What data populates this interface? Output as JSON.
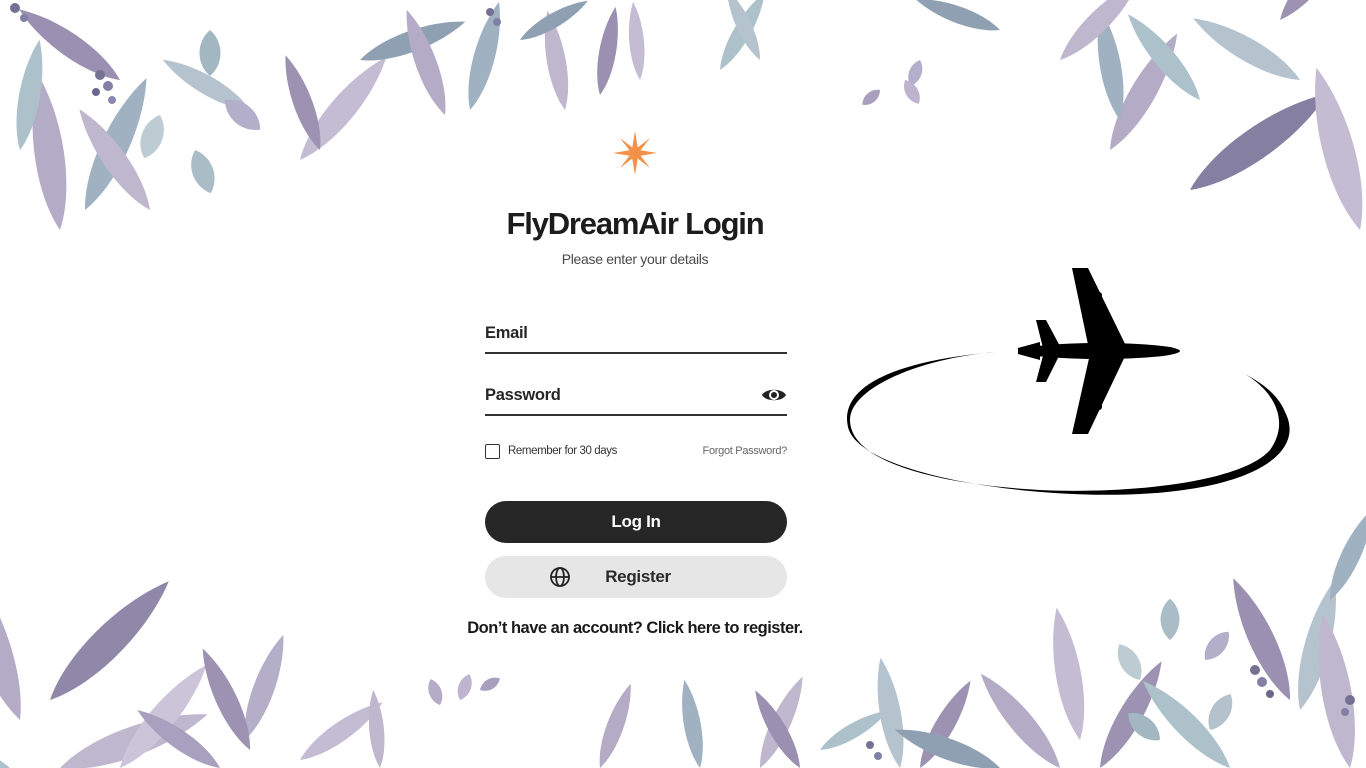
{
  "login": {
    "title": "FlyDreamAir Login",
    "subtitle": "Please enter your details",
    "email_label": "Email",
    "password_label": "Password",
    "remember_label": "Remember for 30 days",
    "remember_checked": false,
    "forgot_label": "Forgot Password?",
    "login_label": "Log In",
    "register_label": "Register",
    "signup_text": "Don’t have an account? Click here to register."
  },
  "icons": {
    "star": "star-icon",
    "eye": "eye-icon",
    "globe": "globe-icon",
    "plane": "airplane-logo"
  },
  "colors": {
    "primary_button": "#262626",
    "secondary_button": "#e6e6e6",
    "star_accent": "#f39148",
    "leaf_purple": "#8c7fa5",
    "leaf_teal": "#8fb0bd"
  }
}
